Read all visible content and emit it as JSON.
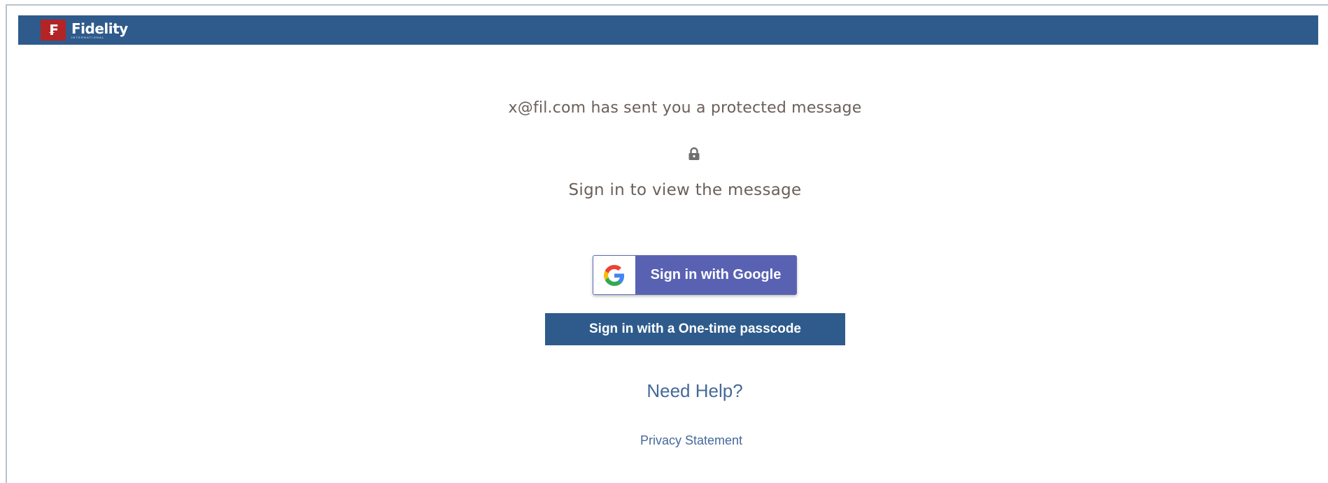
{
  "header": {
    "logo_mark": "₣",
    "logo_text": "Fidelity",
    "logo_subtext": "INTERNATIONAL",
    "brand_color": "#2e5b8c",
    "logo_badge_color": "#b32425"
  },
  "main": {
    "headline": "x@fil.com has sent you a protected message",
    "lock_icon": "lock-icon",
    "subline": "Sign in to view the message"
  },
  "actions": {
    "google_label": "Sign in with Google",
    "google_button_color": "#5962b2",
    "otp_label": "Sign in with a One-time passcode",
    "otp_button_color": "#2e5b8c"
  },
  "footer": {
    "help_label": "Need Help?",
    "privacy_label": "Privacy Statement",
    "link_color": "#44699a"
  }
}
